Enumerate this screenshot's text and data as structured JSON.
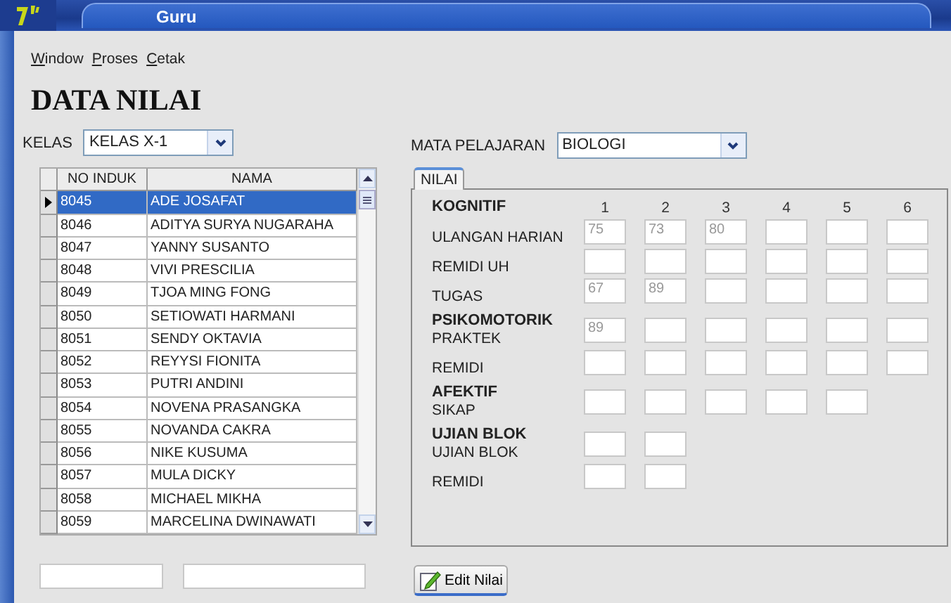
{
  "window": {
    "title": "Guru"
  },
  "menu": [
    {
      "label": "Window"
    },
    {
      "label": "Proses"
    },
    {
      "label": "Cetak"
    }
  ],
  "page_title": "DATA NILAI",
  "kelas": {
    "label": "KELAS",
    "value": "KELAS X-1"
  },
  "mata_pelajaran": {
    "label": "MATA PELAJARAN",
    "value": "BIOLOGI"
  },
  "students": {
    "columns": [
      "NO INDUK",
      "NAMA"
    ],
    "rows": [
      {
        "no_induk": "8045",
        "nama": "ADE JOSAFAT",
        "selected": true
      },
      {
        "no_induk": "8046",
        "nama": "ADITYA SURYA NUGARAHA",
        "selected": false
      },
      {
        "no_induk": "8047",
        "nama": "YANNY SUSANTO",
        "selected": false
      },
      {
        "no_induk": "8048",
        "nama": "VIVI PRESCILIA",
        "selected": false
      },
      {
        "no_induk": "8049",
        "nama": "TJOA MING FONG",
        "selected": false
      },
      {
        "no_induk": "8050",
        "nama": "SETIOWATI HARMANI",
        "selected": false
      },
      {
        "no_induk": "8051",
        "nama": "SENDY OKTAVIA",
        "selected": false
      },
      {
        "no_induk": "8052",
        "nama": "REYYSI FIONITA",
        "selected": false
      },
      {
        "no_induk": "8053",
        "nama": "PUTRI ANDINI",
        "selected": false
      },
      {
        "no_induk": "8054",
        "nama": "NOVENA PRASANGKA",
        "selected": false
      },
      {
        "no_induk": "8055",
        "nama": "NOVANDA CAKRA",
        "selected": false
      },
      {
        "no_induk": "8056",
        "nama": "NIKE KUSUMA",
        "selected": false
      },
      {
        "no_induk": "8057",
        "nama": "MULA DICKY",
        "selected": false
      },
      {
        "no_induk": "8058",
        "nama": "MICHAEL MIKHA",
        "selected": false
      },
      {
        "no_induk": "8059",
        "nama": "MARCELINA DWINAWATI",
        "selected": false
      }
    ]
  },
  "tabs": [
    {
      "label": "NILAI",
      "selected": true
    }
  ],
  "nilai": {
    "column_numbers": [
      "1",
      "2",
      "3",
      "4",
      "5",
      "6"
    ],
    "sections": [
      {
        "heading": "KOGNITIF",
        "rows": [
          {
            "label": "ULANGAN HARIAN",
            "cells": [
              {
                "value": "75"
              },
              {
                "value": "73"
              },
              {
                "value": "80"
              },
              {},
              {},
              {}
            ]
          },
          {
            "label": "REMIDI UH",
            "cells": [
              {},
              {},
              {},
              {},
              {},
              {}
            ]
          },
          {
            "label": "TUGAS",
            "cells": [
              {
                "value": "67"
              },
              {
                "value": "89"
              },
              {},
              {},
              {},
              {}
            ]
          }
        ]
      },
      {
        "heading": "PSIKOMOTORIK",
        "rows": [
          {
            "label": "PRAKTEK",
            "cells": [
              {
                "value": "89"
              },
              {},
              {},
              {},
              {},
              {}
            ]
          },
          {
            "label": "REMIDI",
            "cells": [
              {},
              {},
              {},
              {},
              {},
              {}
            ]
          }
        ]
      },
      {
        "heading": "AFEKTIF",
        "rows": [
          {
            "label": "SIKAP",
            "cells": [
              {},
              {},
              {},
              {},
              {}
            ]
          }
        ]
      },
      {
        "heading": "UJIAN BLOK",
        "rows": [
          {
            "label": "UJIAN BLOK",
            "cells": [
              {},
              {}
            ]
          },
          {
            "label": "REMIDI",
            "cells": [
              {},
              {}
            ]
          }
        ]
      }
    ]
  },
  "edit_button": {
    "label": "Edit Nilai"
  }
}
